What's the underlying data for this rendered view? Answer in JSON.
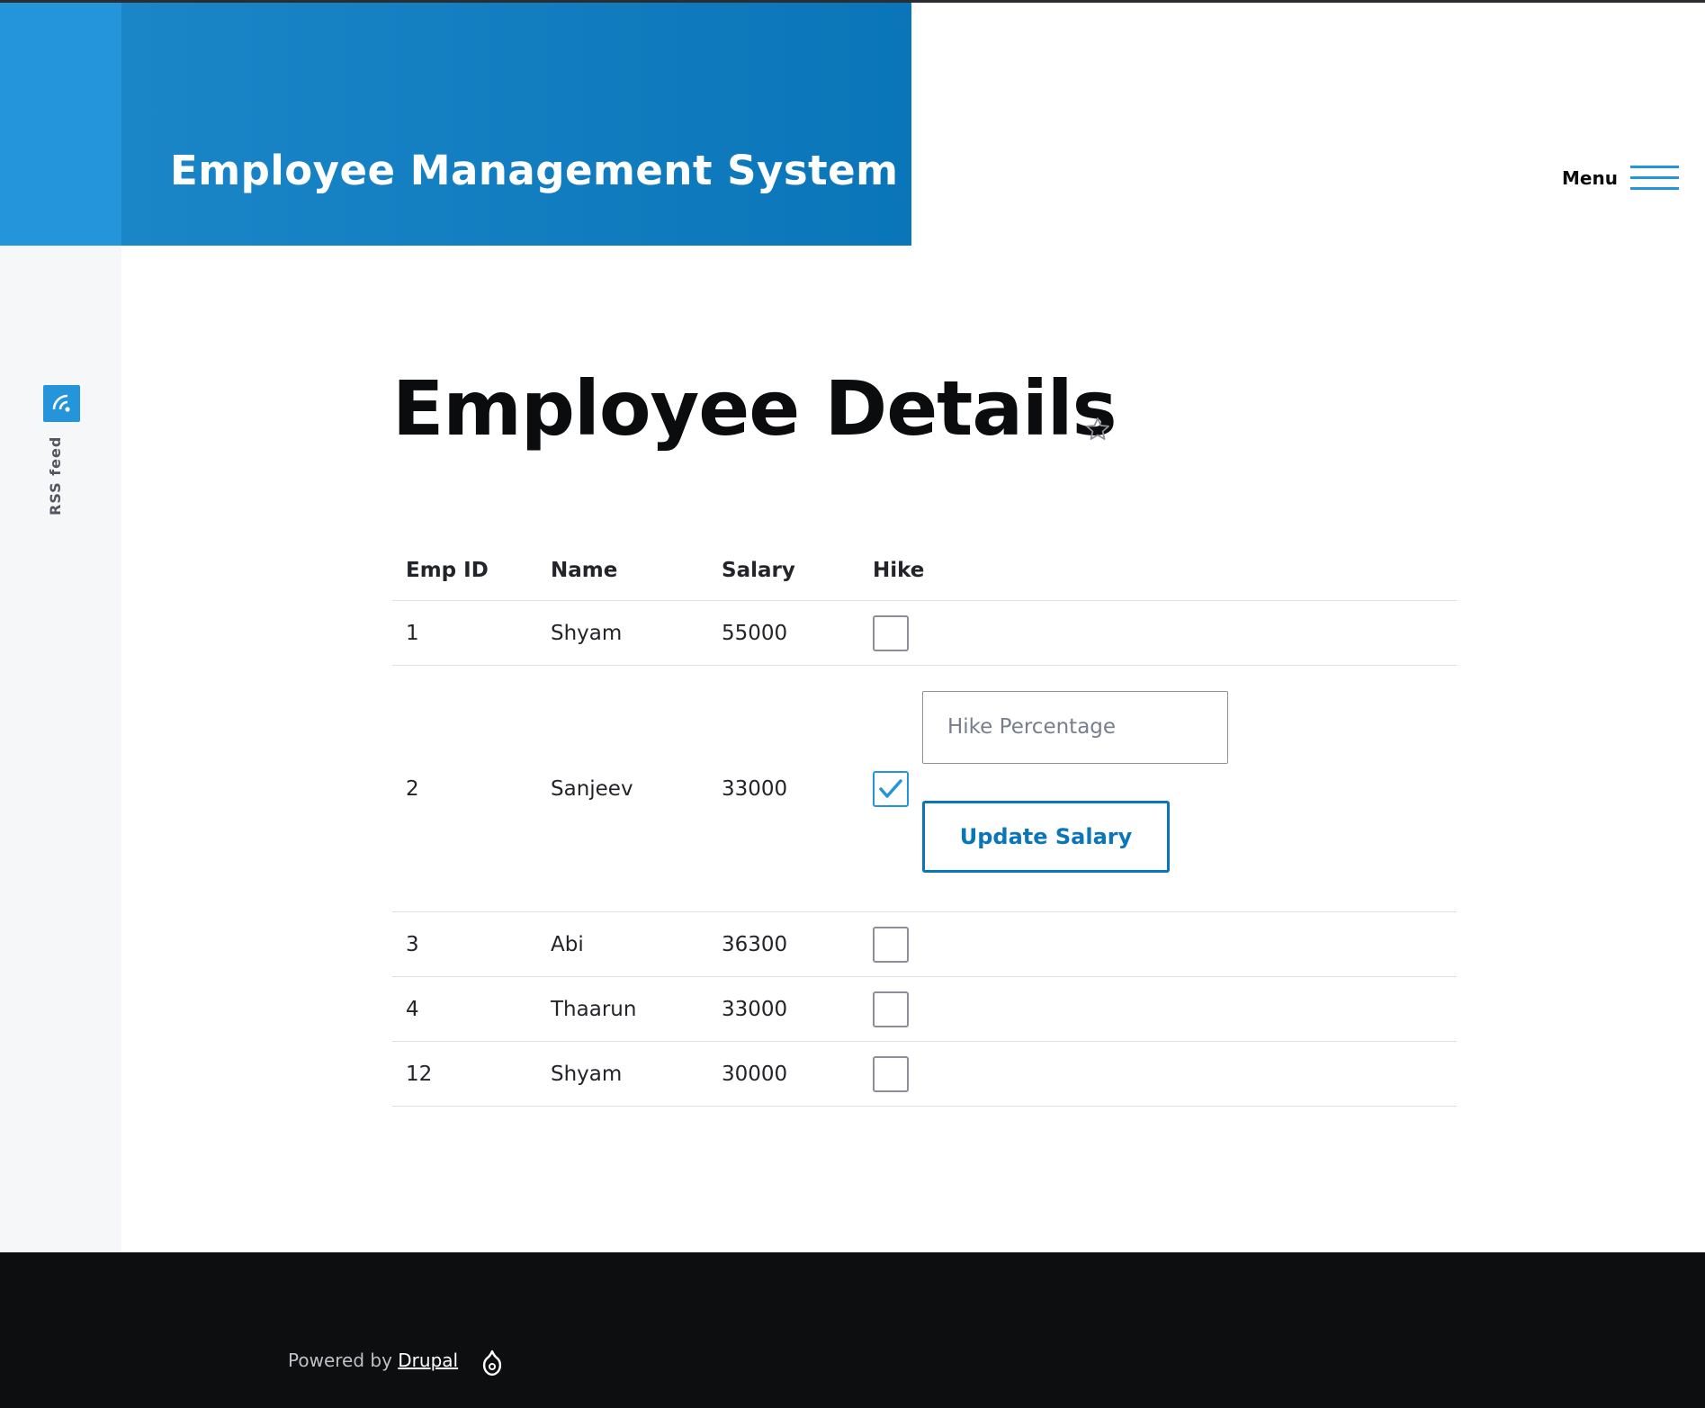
{
  "header": {
    "site_title": "Employee Management System",
    "menu_label": "Menu",
    "menu_icon": "hamburger-icon"
  },
  "sidebar": {
    "rss_label": "RSS feed",
    "rss_icon": "rss-icon"
  },
  "main": {
    "page_title": "Employee Details",
    "bookmark_icon": "star-icon",
    "table": {
      "columns": [
        "Emp ID",
        "Name",
        "Salary",
        "Hike"
      ],
      "rows": [
        {
          "id": "1",
          "name": "Shyam",
          "salary": "55000",
          "hike_checked": false
        },
        {
          "id": "2",
          "name": "Sanjeev",
          "salary": "33000",
          "hike_checked": true
        },
        {
          "id": "3",
          "name": "Abi",
          "salary": "36300",
          "hike_checked": false
        },
        {
          "id": "4",
          "name": "Thaarun",
          "salary": "33000",
          "hike_checked": false
        },
        {
          "id": "12",
          "name": "Shyam",
          "salary": "30000",
          "hike_checked": false
        }
      ],
      "hike_input_placeholder": "Hike Percentage",
      "hike_input_value": "",
      "update_button_label": "Update Salary"
    }
  },
  "footer": {
    "powered_by": "Powered by",
    "drupal_link": "Drupal",
    "drupal_icon": "drupal-drop-icon"
  },
  "colors": {
    "brand_blue": "#2494db",
    "brand_dark_blue": "#0a76b9",
    "footer_bg": "#0d0e10",
    "gutter_bg": "#f6f7f9"
  }
}
